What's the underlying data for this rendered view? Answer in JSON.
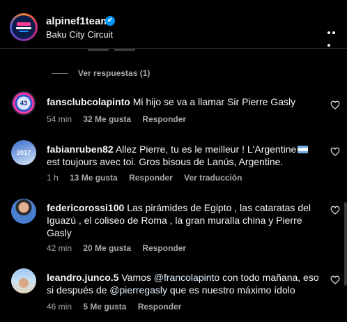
{
  "header": {
    "username": "alpinef1team",
    "location": "Baku City Circuit",
    "verified_icon": "✔"
  },
  "view_replies": "Ver respuestas (1)",
  "comments": [
    {
      "username": "fansclubcolapinto",
      "text": "Mi hijo se va a llamar Sir Pierre Gasly",
      "time": "54 min",
      "likes": "32 Me gusta",
      "reply": "Responder"
    },
    {
      "username": "fabianruben82",
      "text_before_flag": "Allez Pierre, tu es le meilleur ! L'Argentine",
      "flag_icon": "argentina-flag",
      "text_after_flag": "est toujours avec toi. Gros bisous de Lanús, Argentine.",
      "time": "1 h",
      "likes": "13 Me gusta",
      "reply": "Responder",
      "translate": "Ver traducción"
    },
    {
      "username": "federicorossi100",
      "text": "Las pirámides de Egipto , las cataratas del Iguazú , el coliseo de Roma , la gran muralla china y Pierre Gasly",
      "time": "42 min",
      "likes": "20 Me gusta",
      "reply": "Responder"
    },
    {
      "username": "leandro.junco.5",
      "text_1": "Vamos",
      "mention_1": "@francolapinto",
      "text_2": "con todo mañana, eso si después de",
      "mention_2": "@pierregasly",
      "text_3": "que es nuestro máximo ídolo",
      "time": "46 min",
      "likes": "5 Me gusta",
      "reply": "Responder"
    }
  ],
  "colors": {
    "background": "#000000",
    "text": "#f5f5f5",
    "secondary": "#a8a8a8",
    "verified": "#0095f6",
    "mention": "#e0f1ff"
  }
}
